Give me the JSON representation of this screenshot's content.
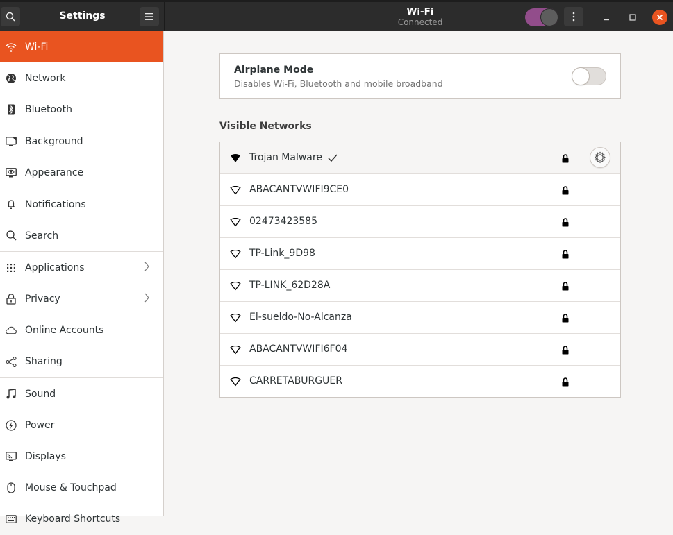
{
  "titlebar": {
    "sidebar_title": "Settings",
    "page_title": "Wi-Fi",
    "page_subtitle": "Connected",
    "wifi_enabled": true,
    "accent_color": "#924d8b",
    "close_color": "#e95420"
  },
  "sidebar": {
    "active_color": "#e95420",
    "items": [
      {
        "label": "Wi-Fi",
        "icon": "wifi-icon",
        "active": true
      },
      {
        "label": "Network",
        "icon": "globe-icon"
      },
      {
        "label": "Bluetooth",
        "icon": "bluetooth-icon"
      },
      {
        "label": "Background",
        "icon": "background-icon"
      },
      {
        "label": "Appearance",
        "icon": "appearance-icon"
      },
      {
        "label": "Notifications",
        "icon": "bell-icon"
      },
      {
        "label": "Search",
        "icon": "search-icon"
      },
      {
        "label": "Applications",
        "icon": "apps-grid-icon",
        "has_submenu": true
      },
      {
        "label": "Privacy",
        "icon": "lock-icon",
        "has_submenu": true
      },
      {
        "label": "Online Accounts",
        "icon": "cloud-icon"
      },
      {
        "label": "Sharing",
        "icon": "share-icon"
      },
      {
        "label": "Sound",
        "icon": "music-note-icon"
      },
      {
        "label": "Power",
        "icon": "power-icon"
      },
      {
        "label": "Displays",
        "icon": "display-icon"
      },
      {
        "label": "Mouse & Touchpad",
        "icon": "mouse-icon"
      },
      {
        "label": "Keyboard Shortcuts",
        "icon": "keyboard-icon"
      }
    ]
  },
  "airplane_mode": {
    "title": "Airplane Mode",
    "description": "Disables Wi-Fi, Bluetooth and mobile broadband",
    "enabled": false
  },
  "visible_networks": {
    "heading": "Visible Networks",
    "networks": [
      {
        "ssid": "Trojan Malware",
        "connected": true,
        "secured": true,
        "signal": "strong"
      },
      {
        "ssid": "ABACANTVWIFI9CE0",
        "connected": false,
        "secured": true,
        "signal": "weak"
      },
      {
        "ssid": "02473423585",
        "connected": false,
        "secured": true,
        "signal": "weak"
      },
      {
        "ssid": "TP-Link_9D98",
        "connected": false,
        "secured": true,
        "signal": "weak"
      },
      {
        "ssid": "TP-LINK_62D28A",
        "connected": false,
        "secured": true,
        "signal": "weak"
      },
      {
        "ssid": "El-sueldo-No-Alcanza",
        "connected": false,
        "secured": true,
        "signal": "weak"
      },
      {
        "ssid": "ABACANTVWIFI6F04",
        "connected": false,
        "secured": true,
        "signal": "weak"
      },
      {
        "ssid": "CARRETABURGUER",
        "connected": false,
        "secured": true,
        "signal": "weak"
      }
    ]
  }
}
